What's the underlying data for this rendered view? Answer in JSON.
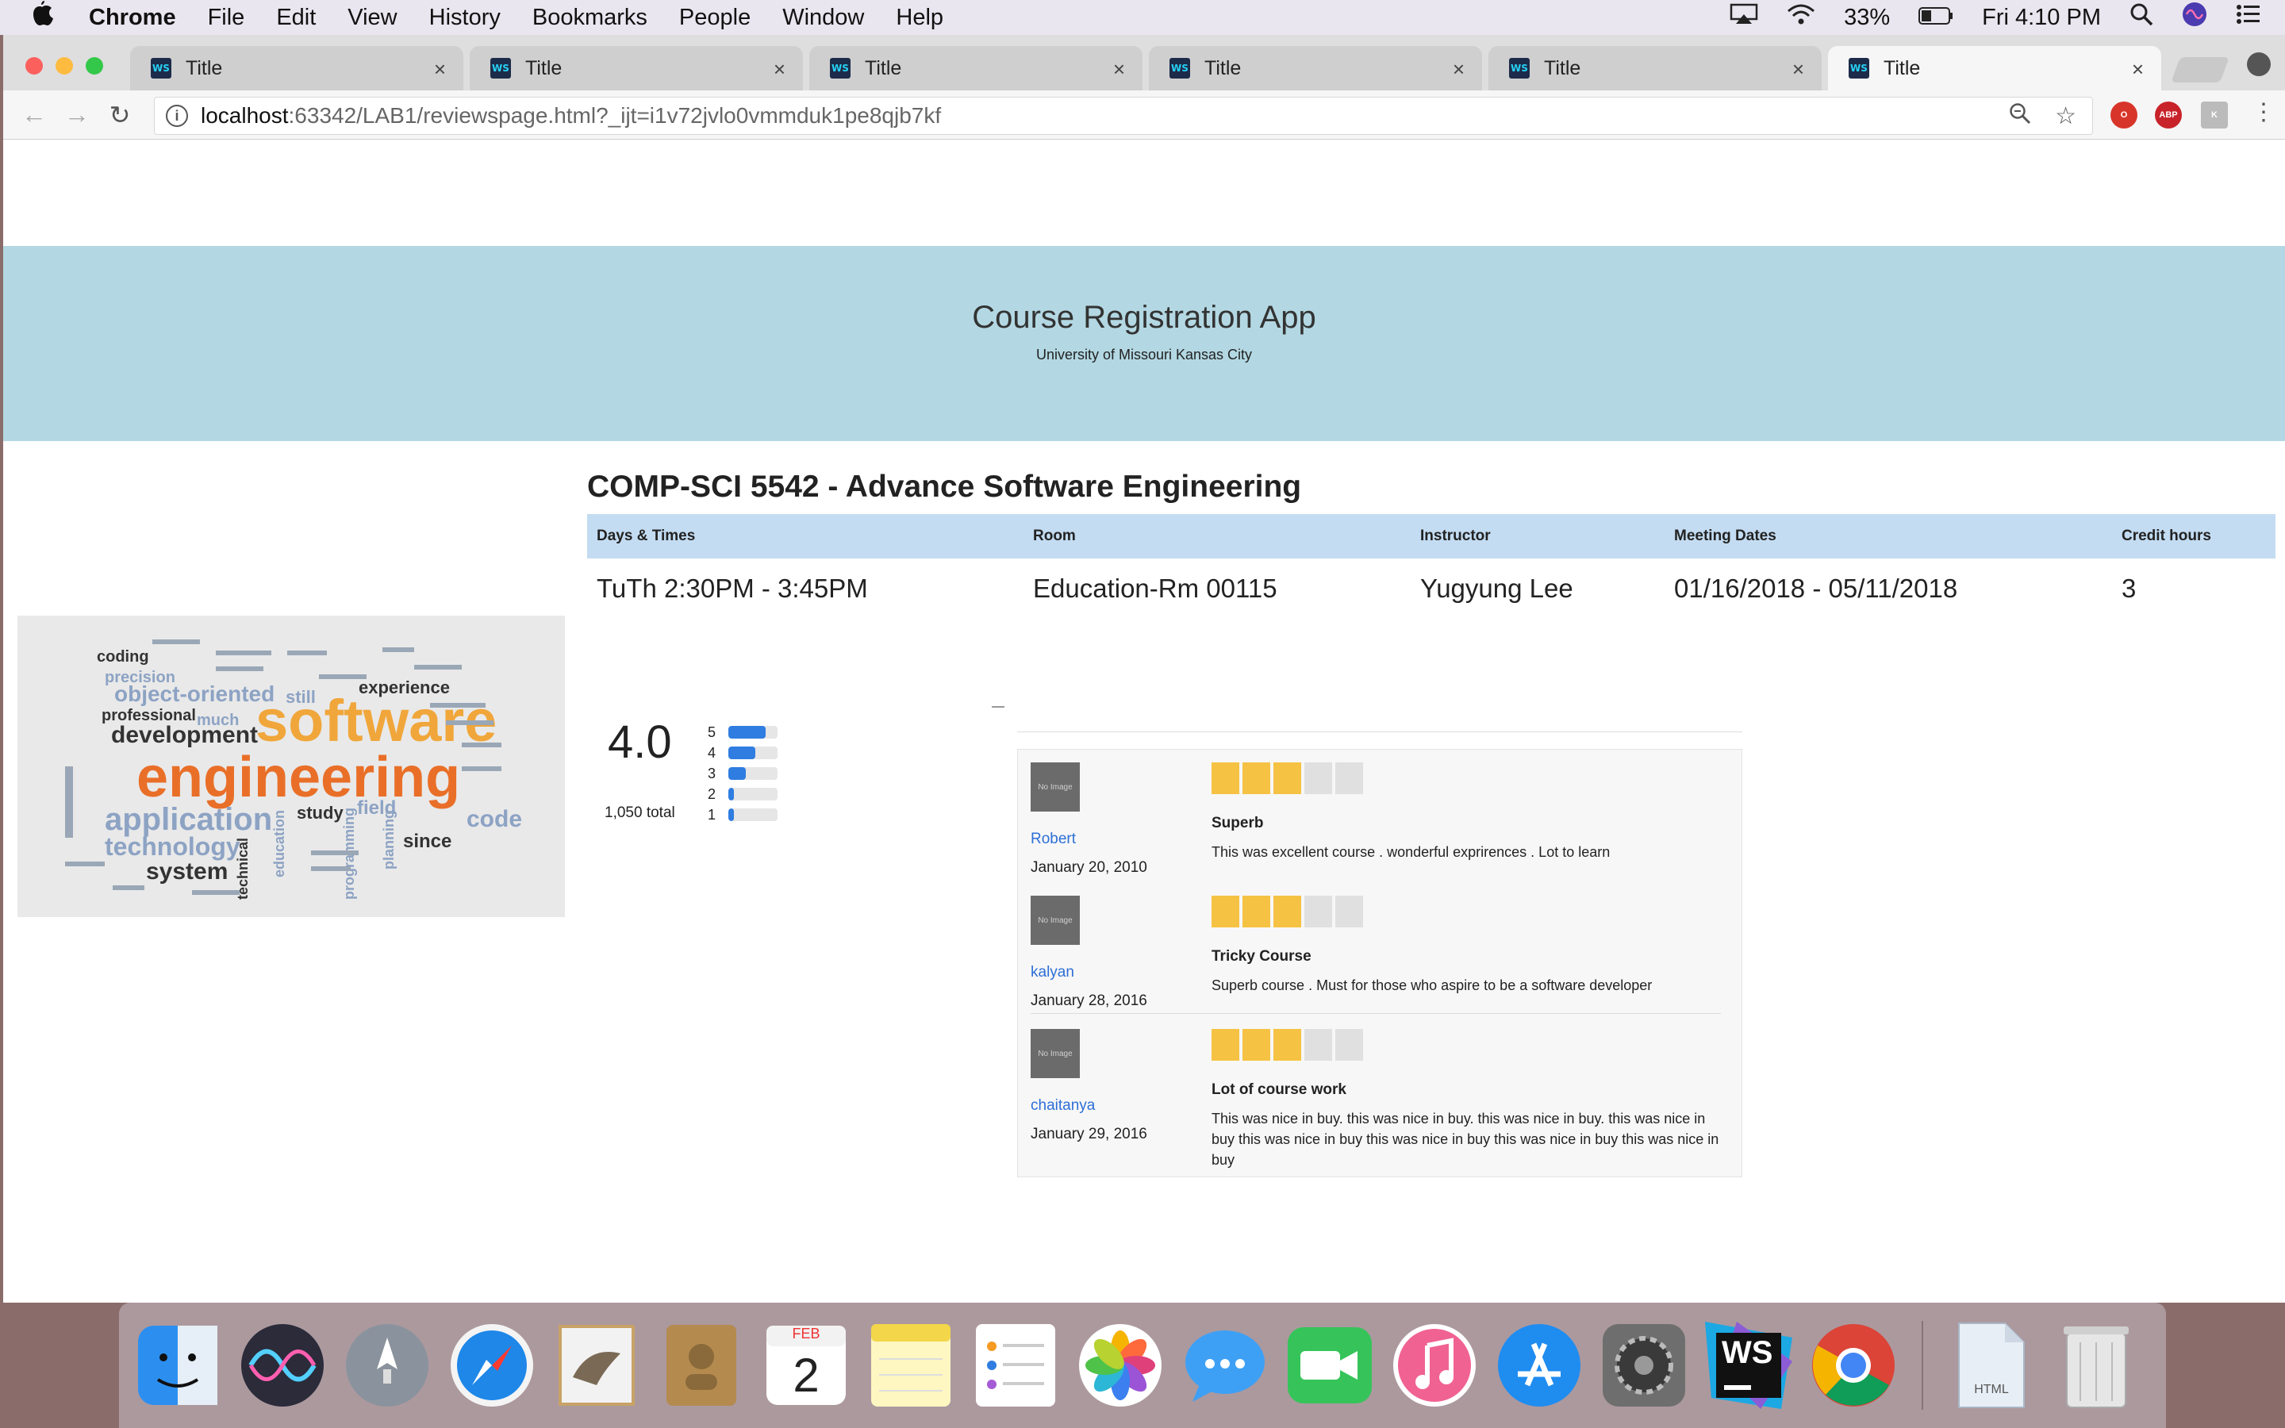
{
  "menubar": {
    "apple": "",
    "app_name": "Chrome",
    "items": [
      "File",
      "Edit",
      "View",
      "History",
      "Bookmarks",
      "People",
      "Window",
      "Help"
    ],
    "battery": "33%",
    "clock": "Fri 4:10 PM"
  },
  "browser": {
    "tabs": [
      {
        "title": "Title",
        "favicon": "WS"
      },
      {
        "title": "Title",
        "favicon": "WS"
      },
      {
        "title": "Title",
        "favicon": "WS"
      },
      {
        "title": "Title",
        "favicon": "WS"
      },
      {
        "title": "Title",
        "favicon": "WS"
      },
      {
        "title": "Title",
        "favicon": "WS"
      }
    ],
    "url_host": "localhost",
    "url_path": ":63342/LAB1/reviewspage.html?_ijt=i1v72jvlo0vmmduk1pe8qjb7kf",
    "extensions": {
      "abp": "ABP"
    }
  },
  "header": {
    "title": "Course Registration App",
    "subtitle": "University of Missouri Kansas City"
  },
  "course": {
    "title": "COMP-SCI 5542 - Advance Software Engineering",
    "columns": [
      "Days & Times",
      "Room",
      "Instructor",
      "Meeting Dates",
      "Credit hours"
    ],
    "row": [
      "TuTh 2:30PM - 3:45PM",
      "Education-Rm 00115",
      "Yugyung Lee",
      "01/16/2018 - 05/11/2018",
      "3"
    ]
  },
  "rating": {
    "average": "4.0",
    "total": "1,050 total",
    "distribution": [
      {
        "label": "5",
        "fraction": 0.75
      },
      {
        "label": "4",
        "fraction": 0.55
      },
      {
        "label": "3",
        "fraction": 0.35
      },
      {
        "label": "2",
        "fraction": 0.12
      },
      {
        "label": "1",
        "fraction": 0.12
      }
    ]
  },
  "reviews": [
    {
      "thumb": "No Image",
      "author": "Robert",
      "date": "January 20, 2010",
      "stars": 3,
      "headline": "Superb",
      "body": "This was excellent course . wonderful exprirences . Lot to learn"
    },
    {
      "thumb": "No Image",
      "author": "kalyan",
      "date": "January 28, 2016",
      "stars": 3,
      "headline": "Tricky Course",
      "body": "Superb course . Must for those who aspire to be a software developer"
    },
    {
      "thumb": "No Image",
      "author": "chaitanya",
      "date": "January 29, 2016",
      "stars": 3,
      "headline": "Lot of course work",
      "body": "This was nice in buy. this was nice in buy. this was nice in buy. this was nice in buy this was nice in buy this was nice in buy this was nice in buy this was nice in buy"
    }
  ],
  "word_cloud": {
    "words": [
      "software",
      "engineering",
      "development",
      "application",
      "object-oriented",
      "technology",
      "system",
      "professional",
      "precision",
      "coding",
      "experience",
      "study",
      "field",
      "code",
      "since",
      "much",
      "still",
      "technical",
      "education",
      "programming",
      "planning"
    ]
  },
  "dock": {
    "apps": [
      {
        "name": "finder-icon",
        "color": "#2c8ff0"
      },
      {
        "name": "siri-icon",
        "color": "#3a2d6e"
      },
      {
        "name": "launchpad-icon",
        "color": "#7d8591"
      },
      {
        "name": "safari-icon",
        "color": "#1e87e8"
      },
      {
        "name": "mail-icon",
        "color": "#a7c8e6"
      },
      {
        "name": "contacts-icon",
        "color": "#b58a4f"
      },
      {
        "name": "calendar-icon",
        "color": "#f5f5f5"
      },
      {
        "name": "notes-icon",
        "color": "#f8e27a"
      },
      {
        "name": "reminders-icon",
        "color": "#f4f4f4"
      },
      {
        "name": "photos-icon",
        "color": "#f3f3f3"
      },
      {
        "name": "messages-icon",
        "color": "#3ea0f5"
      },
      {
        "name": "facetime-icon",
        "color": "#36c45a"
      },
      {
        "name": "itunes-icon",
        "color": "#f06292"
      },
      {
        "name": "app-store-icon",
        "color": "#1f8cf0"
      },
      {
        "name": "system-preferences-icon",
        "color": "#6e6e6e"
      },
      {
        "name": "webstorm-icon",
        "color": "#1c2432"
      },
      {
        "name": "chrome-icon",
        "color": "#e8e8e8"
      },
      {
        "name": "html-file-icon",
        "color": "#dce6f0"
      },
      {
        "name": "trash-icon",
        "color": "#d8d8d8"
      }
    ],
    "calendar_month": "FEB",
    "calendar_day": "2",
    "webstorm_label": "WS",
    "html_label": "HTML"
  },
  "colors": {
    "jumbotron": "#b3d8e3",
    "table_header": "#c3dcf2",
    "star_on": "#f6c244",
    "star_off": "#e0e0e0",
    "bar": "#2f7de1",
    "link": "#2d6fd6"
  }
}
